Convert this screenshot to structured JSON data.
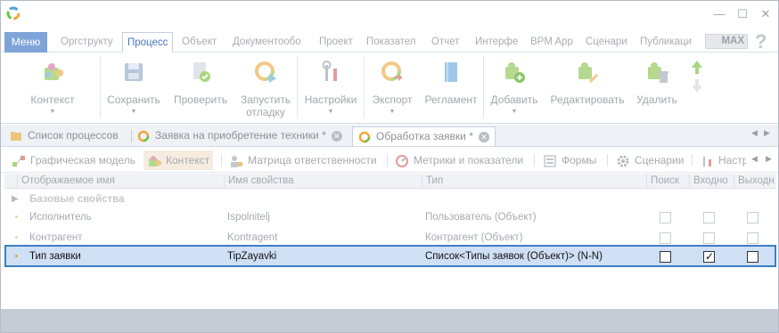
{
  "window": {
    "controls": {
      "minimize": "—",
      "maximize": "☐",
      "close": "✕"
    }
  },
  "ribbon_tabs": {
    "menu": "Меню",
    "items": [
      "Оргструкту",
      "Процесс",
      "Объект",
      "Документообо",
      "Проект",
      "Показател",
      "Отчет",
      "Интерфе",
      "BPM App",
      "Сценари",
      "Публикаци"
    ],
    "active_index": 1,
    "max_label": "MAX",
    "help": "?"
  },
  "ribbon": {
    "context": {
      "label": "Контекст",
      "icon": "puzzle-icon"
    },
    "save": {
      "label": "Сохранить",
      "icon": "save-icon"
    },
    "check": {
      "label": "Проверить",
      "icon": "check-document-icon"
    },
    "run_debug": {
      "label": "Запустить отладку",
      "icon": "run-debug-icon"
    },
    "settings": {
      "label": "Настройки",
      "icon": "tools-icon"
    },
    "export": {
      "label": "Экспорт",
      "icon": "export-icon"
    },
    "regulation": {
      "label": "Регламент",
      "icon": "book-icon"
    },
    "add": {
      "label": "Добавить",
      "icon": "puzzle-add-icon"
    },
    "edit": {
      "label": "Редактировать",
      "icon": "puzzle-edit-icon"
    },
    "delete": {
      "label": "Удалить",
      "icon": "puzzle-delete-icon"
    }
  },
  "doc_tabs": [
    {
      "label": "Список процессов",
      "icon": "folder-icon",
      "closable": false
    },
    {
      "label": "Заявка на приобретение техники *",
      "icon": "process-icon",
      "closable": true
    },
    {
      "label": "Обработка заявки *",
      "icon": "process-icon",
      "closable": true,
      "active": true
    }
  ],
  "sub_toolbar": [
    {
      "label": "Графическая модель",
      "icon": "graph-model-icon"
    },
    {
      "label": "Контекст",
      "icon": "puzzle-icon",
      "active": true
    },
    {
      "label": "Матрица ответственности",
      "icon": "responsibility-matrix-icon"
    },
    {
      "label": "Метрики и показатели",
      "icon": "metrics-icon"
    },
    {
      "label": "Формы",
      "icon": "forms-icon"
    },
    {
      "label": "Сценарии",
      "icon": "gear-icon"
    },
    {
      "label": "Настр",
      "icon": "tools-icon"
    }
  ],
  "grid": {
    "columns": [
      "Отображаемое имя",
      "Имя свойства",
      "Тип",
      "Поиск",
      "Входно",
      "Выходн"
    ],
    "group": "Базовые свойства",
    "rows": [
      {
        "display_name": "Исполнитель",
        "property": "Ispolnitelj",
        "type": "Пользователь (Объект)",
        "search": false,
        "input": false,
        "output": false,
        "selected": false
      },
      {
        "display_name": "Контрагент",
        "property": "Kontragent",
        "type": "Контрагент (Объект)",
        "search": false,
        "input": false,
        "output": false,
        "selected": false
      },
      {
        "display_name": "Тип заявки",
        "property": "TipZayavki",
        "type": "Список<Типы заявок (Объект)> (N-N)",
        "search": false,
        "input": true,
        "output": false,
        "selected": true
      }
    ]
  },
  "colors": {
    "menu_bg": "#7ea4d8",
    "accent": "#4a78b8",
    "selection_bg": "#cfe0f5",
    "selection_border": "#3b7fc4",
    "active_subtab_bg": "#f6ece0"
  }
}
